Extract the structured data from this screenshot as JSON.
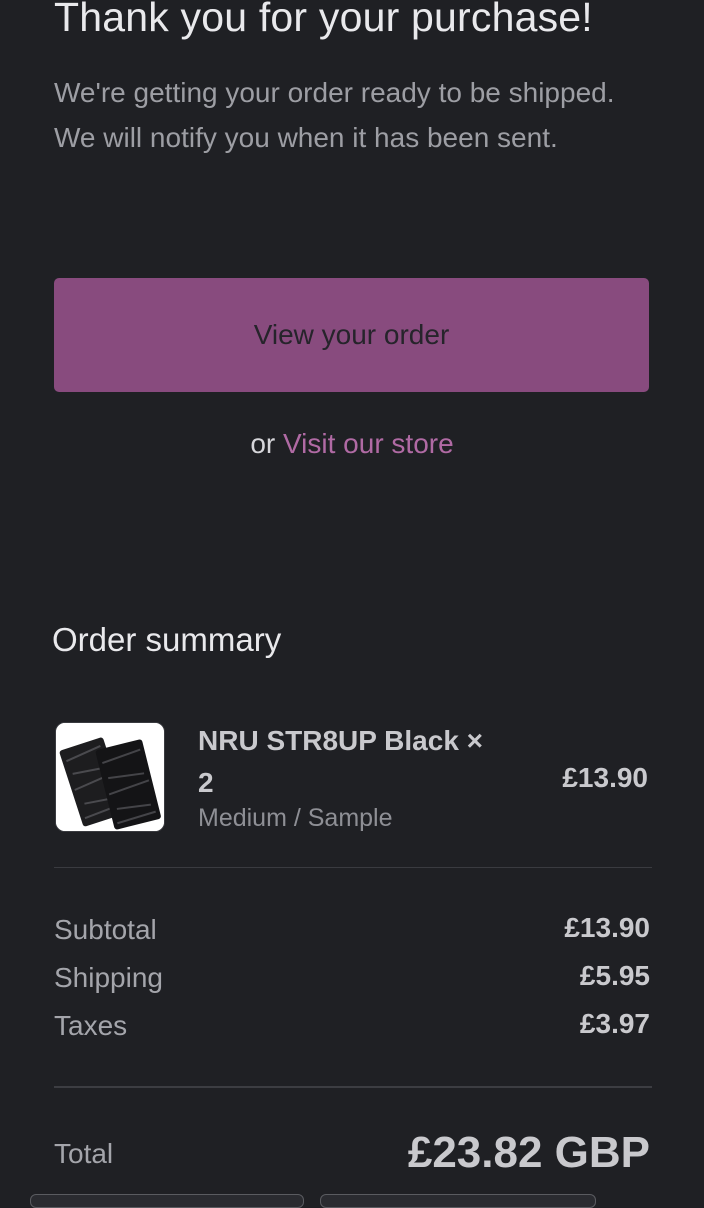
{
  "confirmation": {
    "title": "Thank you for your purchase!",
    "message": "We're getting your order ready to be shipped. We will notify you when it has been sent.",
    "view_order_label": "View your order",
    "or_text": "or",
    "visit_store_label": "Visit our store"
  },
  "summary": {
    "title": "Order summary",
    "item": {
      "name": "NRU STR8UP Black × 2",
      "variant": "Medium / Sample",
      "price": "£13.90",
      "thumbnail_icon": "black-pouch-product-image"
    },
    "costs": [
      {
        "label": "Subtotal",
        "value": "£13.90"
      },
      {
        "label": "Shipping",
        "value": "£5.95"
      },
      {
        "label": "Taxes",
        "value": "£3.97"
      }
    ],
    "total_label": "Total",
    "total_value": "£23.82 GBP"
  },
  "colors": {
    "background": "#1f2024",
    "accent_button": "#884b7e",
    "link": "#b06aa4"
  }
}
